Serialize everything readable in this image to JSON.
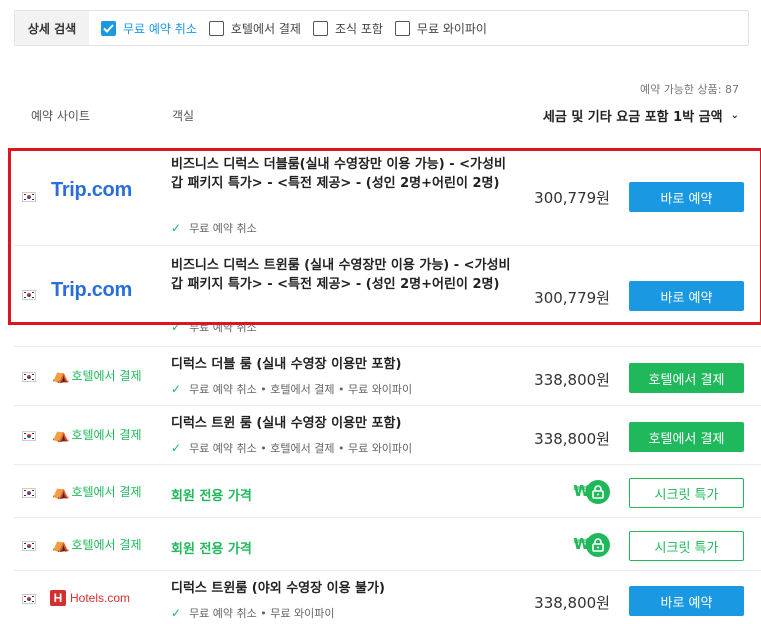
{
  "filters": {
    "label": "상세 검색",
    "options": [
      {
        "label": "무료 예약 취소",
        "checked": true
      },
      {
        "label": "호텔에서 결제",
        "checked": false
      },
      {
        "label": "조식 포함",
        "checked": false
      },
      {
        "label": "무료 와이파이",
        "checked": false
      }
    ]
  },
  "available_count": "예약 가능한 상품: 87",
  "headers": {
    "site": "예약 사이트",
    "room": "객실",
    "price": "세금 및 기타 요금 포함 1박 금액"
  },
  "rows": [
    {
      "site": "Trip.com",
      "room": "비즈니스 디럭스 더블룸(실내 수영장만 이용 가능) - <가성비갑 패키지 특가> - <특전 제공> - (성인 2명+어린이 2명)",
      "perks": "무료 예약 취소",
      "price": "300,779원",
      "button": "바로 예약"
    },
    {
      "site": "Trip.com",
      "room": "비즈니스 디럭스 트윈룸 (실내 수영장만 이용 가능) - <가성비갑 패키지 특가> - <특전 제공> - (성인 2명+어린이 2명)",
      "perks": "무료 예약 취소",
      "price": "300,779원",
      "button": "바로 예약"
    },
    {
      "site": "호텔에서 결제",
      "room": "디럭스 더블 룸 (실내 수영장 이용만 포함)",
      "perks": "무료 예약 취소 • 호텔에서 결제 • 무료 와이파이",
      "price": "338,800원",
      "button": "호텔에서 결제"
    },
    {
      "site": "호텔에서 결제",
      "room": "디럭스 트윈 룸 (실내 수영장 이용만 포함)",
      "perks": "무료 예약 취소 • 호텔에서 결제 • 무료 와이파이",
      "price": "338,800원",
      "button": "호텔에서 결제"
    },
    {
      "site": "호텔에서 결제",
      "room": "회원 전용 가격",
      "price": "₩",
      "button": "시크릿 특가"
    },
    {
      "site": "호텔에서 결제",
      "room": "회원 전용 가격",
      "price": "₩",
      "button": "시크릿 특가"
    },
    {
      "site": "Hotels.com",
      "room": "디럭스 트윈룸 (야외 수영장 이용 불가)",
      "perks": "무료 예약 취소 • 무료 와이파이",
      "price": "338,800원",
      "button": "바로 예약"
    }
  ],
  "colors": {
    "accent_blue": "#1a98e2",
    "accent_green": "#1fb85a",
    "highlight_red": "#e0141e"
  }
}
